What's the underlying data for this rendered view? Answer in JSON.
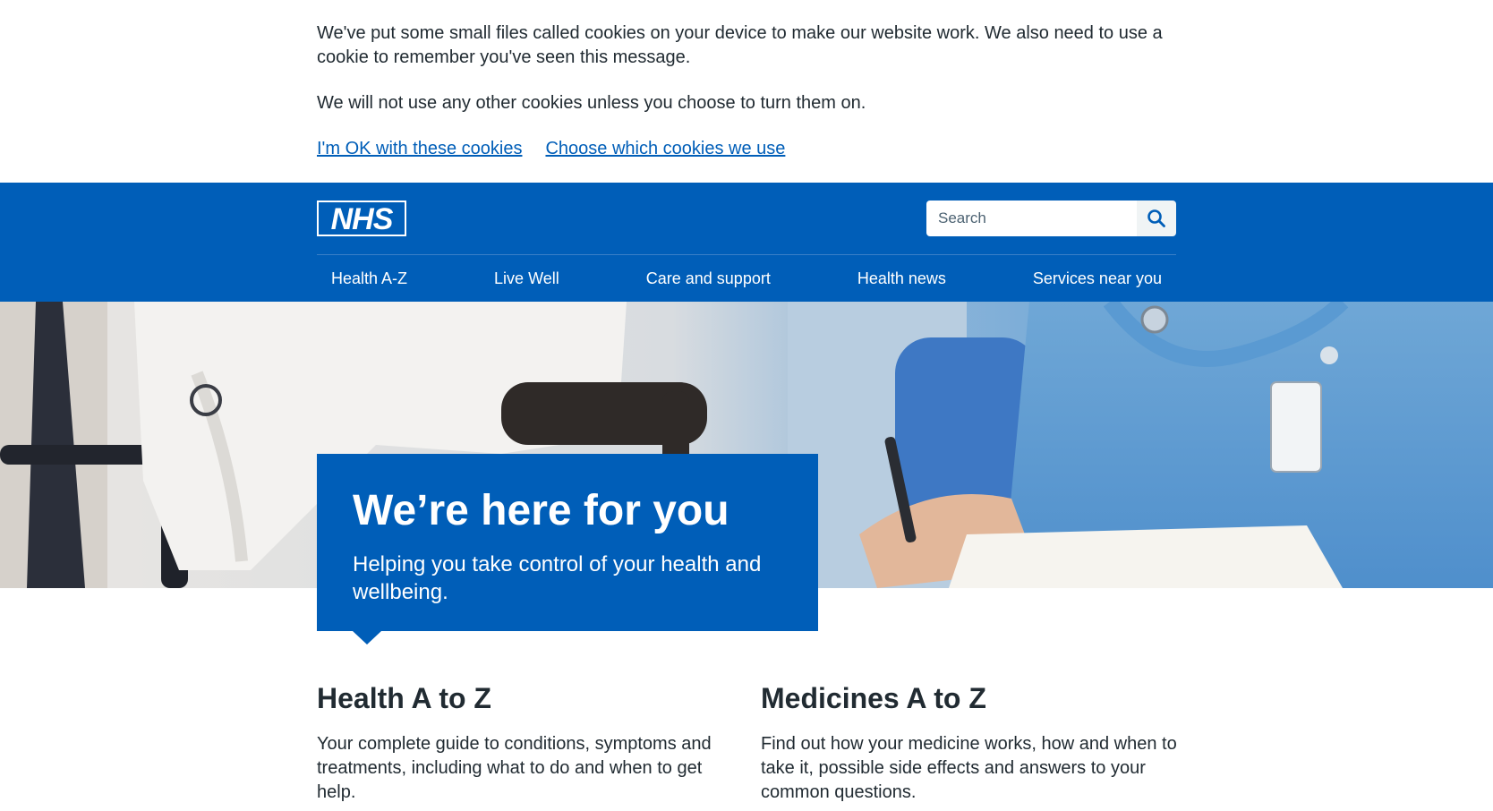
{
  "cookie_banner": {
    "paragraph1": "We've put some small files called cookies on your device to make our website work. We also need to use a cookie to remember you've seen this message.",
    "paragraph2": "We will not use any other cookies unless you choose to turn them on.",
    "accept_link": "I'm OK with these cookies",
    "choose_link": "Choose which cookies we use"
  },
  "header": {
    "logo_text": "NHS",
    "search_placeholder": "Search",
    "nav": [
      {
        "label": "Health A-Z"
      },
      {
        "label": "Live Well"
      },
      {
        "label": "Care and support"
      },
      {
        "label": "Health news"
      },
      {
        "label": "Services near you"
      }
    ]
  },
  "hero": {
    "title": "We’re here for you",
    "subtitle": "Helping you take control of your health and wellbeing."
  },
  "cards": [
    {
      "title": "Health A to Z",
      "description": "Your complete guide to conditions, symptoms and treatments, including what to do and when to get help."
    },
    {
      "title": "Medicines A to Z",
      "description": "Find out how your medicine works, how and when to take it, possible side effects and answers to your common questions."
    }
  ],
  "colors": {
    "nhs_blue": "#005eb8",
    "text": "#212b32",
    "white": "#ffffff"
  },
  "icons": {
    "search": "search-icon",
    "logo": "nhs-logo"
  }
}
